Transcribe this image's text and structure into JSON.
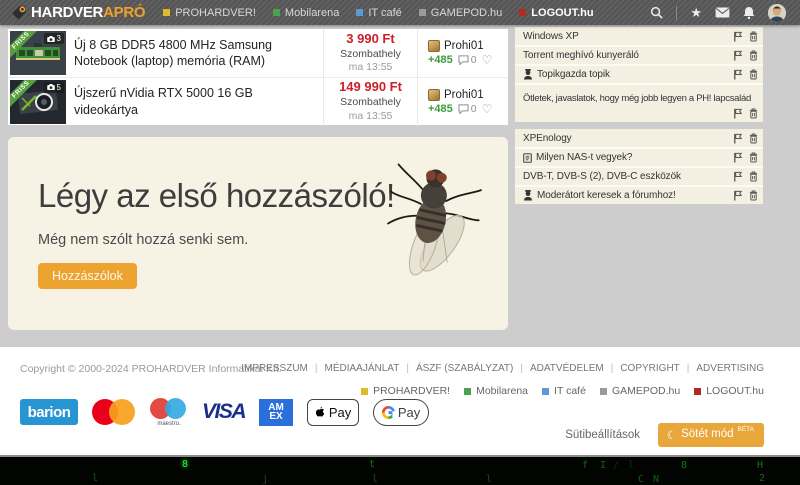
{
  "header": {
    "logo_part1": "HARDVER",
    "logo_part2": "APRÓ",
    "nav": [
      {
        "label": "PROHARDVER!",
        "color": "#e0ba28"
      },
      {
        "label": "Mobilarena",
        "color": "#4aa34a"
      },
      {
        "label": "IT café",
        "color": "#5b9bd5"
      },
      {
        "label": "GAMEPOD.hu",
        "color": "#9a9a9a"
      },
      {
        "label": "LOGOUT.hu",
        "color": "#b12a21"
      }
    ]
  },
  "glyphs": {
    "star": "★",
    "heart": "♡",
    "moon": "☾"
  },
  "listings": [
    {
      "title": "Új 8 GB DDR5 4800 MHz Samsung Notebook (laptop) memória (RAM)",
      "badge": "FRISS",
      "photo_count": "3",
      "price": "3 990 Ft",
      "location": "Szombathely",
      "time": "ma 13:55",
      "seller": "Prohi01",
      "rating": "+485",
      "comments": "0"
    },
    {
      "title": "Újszerű nVidia RTX 5000 16 GB videokártya",
      "badge": "FRISS",
      "photo_count": "5",
      "price": "149 990 Ft",
      "location": "Szombathely",
      "time": "ma 13:55",
      "seller": "Prohi01",
      "rating": "+485",
      "comments": "0"
    }
  ],
  "banner": {
    "title": "Légy az első hozzászóló!",
    "subtitle": "Még nem szólt hozzá senki sem.",
    "button_label": "Hozzászólok"
  },
  "sidebar": {
    "items": [
      {
        "label": "Windows XP",
        "icon": null
      },
      {
        "label": "Torrent meghívó kunyeráló",
        "icon": null
      },
      {
        "label": "Topikgazda topik",
        "icon": "owner"
      },
      {
        "label": "Ötletek, javaslatok, hogy még jobb legyen a PH! lapcsalád",
        "icon": null
      },
      {
        "label": "XPEnology",
        "icon": null
      },
      {
        "label": "Milyen NAS-t vegyek?",
        "icon": "memo"
      },
      {
        "label": "DVB-T, DVB-S (2), DVB-C eszközök",
        "icon": null
      },
      {
        "label": "Moderátort keresek a fórumhoz!",
        "icon": "owner"
      }
    ]
  },
  "footer": {
    "copyright": "Copyright © 2000-2024 PROHARDVER Informatikai Kft.",
    "links": [
      "IMPRESSZUM",
      "MÉDIAAJÁNLAT",
      "ÁSZF (SZABÁLYZAT)",
      "ADATVÉDELEM",
      "COPYRIGHT",
      "ADVERTISING"
    ],
    "brands": [
      "PROHARDVER!",
      "Mobilarena",
      "IT café",
      "GAMEPOD.hu",
      "LOGOUT.hu"
    ],
    "payments": {
      "barion": "barion",
      "maestro_caption": "maestro.",
      "visa": "VISA",
      "amex": "AMEX",
      "apple_pay": "Pay",
      "gpay": "Pay"
    },
    "cookie_settings": "Sütibeállítások",
    "dark_mode_label": "Sötét mód",
    "dark_mode_beta": "BÉTA"
  },
  "desktop": {
    "glyphs": [
      "l",
      "8",
      "j",
      "t",
      "l",
      "l",
      "f",
      "I",
      "/",
      "l",
      "C",
      "N",
      "8",
      "H",
      "2"
    ]
  },
  "colors": {
    "accent_orange": "#eda32f",
    "price_red": "#cb2027",
    "rating_green": "#3c9a3c",
    "ribbon_green": "#55a03d",
    "banner_cream": "#f6f2e4",
    "sidebar_cream": "#f3f0e2",
    "header_gray": "#585858"
  }
}
